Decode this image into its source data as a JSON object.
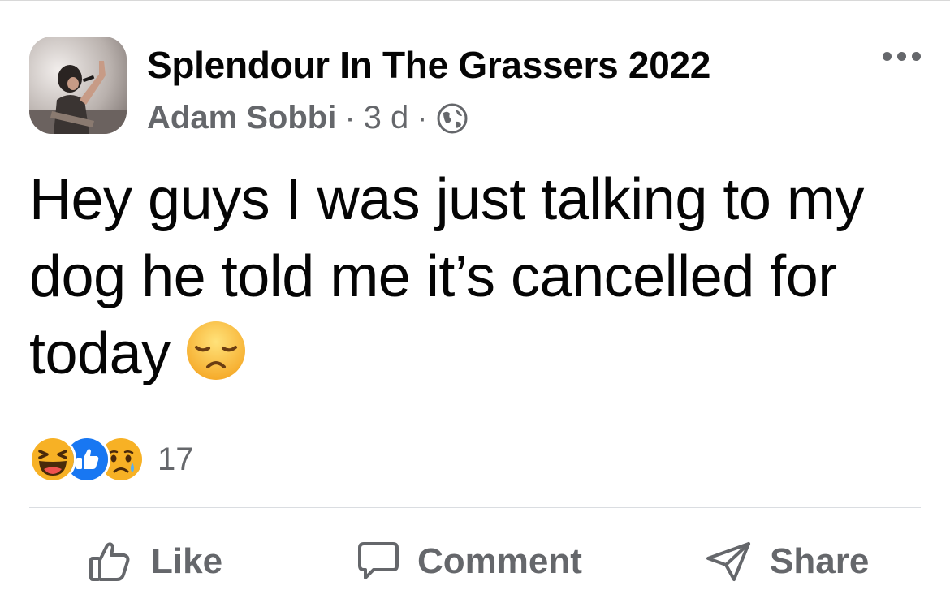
{
  "post": {
    "group_name": "Splendour In The Grassers 2022",
    "author": "Adam Sobbi",
    "dot1": "·",
    "time": "3 d",
    "dot2": "·",
    "privacy_icon": "globe-icon",
    "more_icon": "more-dots-icon",
    "avatar_icon": "profile-photo",
    "text": "Hey guys I was just talking to my dog he told me it’s cancelled for today",
    "text_emoji": "disappointed-face-emoji"
  },
  "reactions": {
    "icons": [
      "haha-reaction-icon",
      "like-reaction-icon",
      "sad-reaction-icon"
    ],
    "count": "17"
  },
  "actions": {
    "like_label": "Like",
    "comment_label": "Comment",
    "share_label": "Share"
  },
  "colors": {
    "text": "#050505",
    "secondary": "#65676b",
    "like_blue": "#1877f2",
    "emoji_yellow": "#f7b125"
  }
}
